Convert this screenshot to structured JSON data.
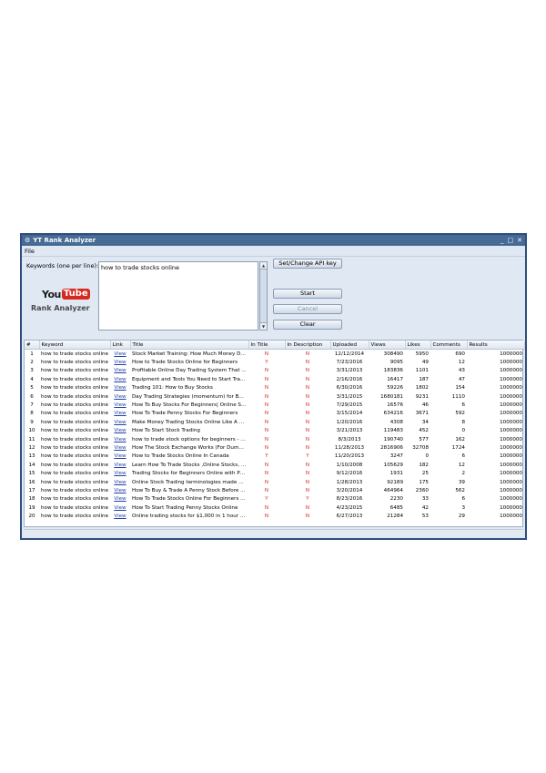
{
  "window": {
    "title": "YT Rank Analyzer",
    "icon": "app-icon",
    "controls": [
      "_",
      "□",
      "✕"
    ]
  },
  "menu": {
    "file": "File"
  },
  "keywords": {
    "label": "Keywords (one per line):",
    "value": "how to trade stocks online"
  },
  "brand": {
    "you": "You",
    "tube": "Tube",
    "name": "Rank Analyzer",
    "colors": {
      "tube_bg": "#d72a1f"
    }
  },
  "buttons": {
    "api": "Set/Change API key",
    "start": "Start",
    "cancel": "Cancel",
    "clear": "Clear"
  },
  "table": {
    "columns": [
      "#",
      "Keyword",
      "Link",
      "Title",
      "In Title",
      "In Description",
      "Uploaded",
      "Views",
      "Likes",
      "Comments",
      "Results"
    ],
    "rows": [
      [
        "1",
        "how to trade stocks online",
        "View",
        "Stock Market Training: How Much Money Do...",
        "N",
        "N",
        "12/12/2014",
        "308490",
        "5950",
        "690",
        "1000000"
      ],
      [
        "2",
        "how to trade stocks online",
        "View",
        "How to Trade Stocks Online for Beginners",
        "Y",
        "N",
        "7/23/2016",
        "9095",
        "49",
        "12",
        "1000000"
      ],
      [
        "3",
        "how to trade stocks online",
        "View",
        "Profitable Online Day Trading System That ...",
        "N",
        "N",
        "3/31/2013",
        "183836",
        "1101",
        "43",
        "1000000"
      ],
      [
        "4",
        "how to trade stocks online",
        "View",
        "Equipment and Tools You Need to Start Tra...",
        "N",
        "N",
        "2/16/2016",
        "16417",
        "187",
        "47",
        "1000000"
      ],
      [
        "5",
        "how to trade stocks online",
        "View",
        "Trading 101: How to Buy Stocks",
        "N",
        "N",
        "6/30/2016",
        "59226",
        "1802",
        "154",
        "1000000"
      ],
      [
        "6",
        "how to trade stocks online",
        "View",
        "Day Trading Strategies (momentum) for Beg...",
        "N",
        "N",
        "3/31/2015",
        "1680181",
        "9231",
        "1110",
        "1000000"
      ],
      [
        "7",
        "how to trade stocks online",
        "View",
        "How To Buy Stocks For Beginners| Online St...",
        "N",
        "N",
        "7/29/2015",
        "16576",
        "46",
        "6",
        "1000000"
      ],
      [
        "8",
        "how to trade stocks online",
        "View",
        "How To Trade Penny Stocks For Beginners",
        "N",
        "N",
        "3/15/2014",
        "634216",
        "3671",
        "592",
        "1000000"
      ],
      [
        "9",
        "how to trade stocks online",
        "View",
        "Make Money Trading Stocks Online Like A Pr...",
        "N",
        "N",
        "1/20/2016",
        "4308",
        "34",
        "8",
        "1000000"
      ],
      [
        "10",
        "how to trade stocks online",
        "View",
        "How To Start Stock Trading",
        "N",
        "N",
        "3/21/2013",
        "119483",
        "452",
        "0",
        "1000000"
      ],
      [
        "11",
        "how to trade stocks online",
        "View",
        "how to trade stock options for beginners - s...",
        "N",
        "N",
        "8/3/2013",
        "190740",
        "577",
        "162",
        "1000000"
      ],
      [
        "12",
        "how to trade stocks online",
        "View",
        "How The Stock Exchange Works (For Dummi...",
        "N",
        "N",
        "11/28/2013",
        "2816906",
        "32708",
        "1724",
        "1000000"
      ],
      [
        "13",
        "how to trade stocks online",
        "View",
        "How to Trade Stocks Online In Canada",
        "Y",
        "Y",
        "11/20/2013",
        "3247",
        "0",
        "6",
        "1000000"
      ],
      [
        "14",
        "how to trade stocks online",
        "View",
        "Learn How To Trade Stocks ,Online Stocks, ...",
        "N",
        "N",
        "1/10/2008",
        "105629",
        "182",
        "12",
        "1000000"
      ],
      [
        "15",
        "how to trade stocks online",
        "View",
        "Trading Stocks for Beginners Online with Pe...",
        "N",
        "N",
        "9/12/2016",
        "1931",
        "25",
        "2",
        "1000000"
      ],
      [
        "16",
        "how to trade stocks online",
        "View",
        "Online Stock Trading terminologies made easy.",
        "N",
        "N",
        "1/28/2013",
        "92189",
        "175",
        "39",
        "1000000"
      ],
      [
        "17",
        "how to trade stocks online",
        "View",
        "How To Buy & Trade A Penny Stock Before ...",
        "N",
        "N",
        "3/20/2014",
        "464964",
        "2360",
        "562",
        "1000000"
      ],
      [
        "18",
        "how to trade stocks online",
        "View",
        "How To Trade Stocks Online For Beginners ...",
        "Y",
        "Y",
        "8/23/2016",
        "2230",
        "33",
        "6",
        "1000000"
      ],
      [
        "19",
        "how to trade stocks online",
        "View",
        "How To Start Trading Penny Stocks Online",
        "N",
        "N",
        "4/23/2015",
        "6485",
        "42",
        "3",
        "1000000"
      ],
      [
        "20",
        "how to trade stocks online",
        "View",
        "Online trading stocks for $1,000 in 1 hour -...",
        "N",
        "N",
        "6/27/2013",
        "21284",
        "53",
        "29",
        "1000000"
      ]
    ]
  }
}
